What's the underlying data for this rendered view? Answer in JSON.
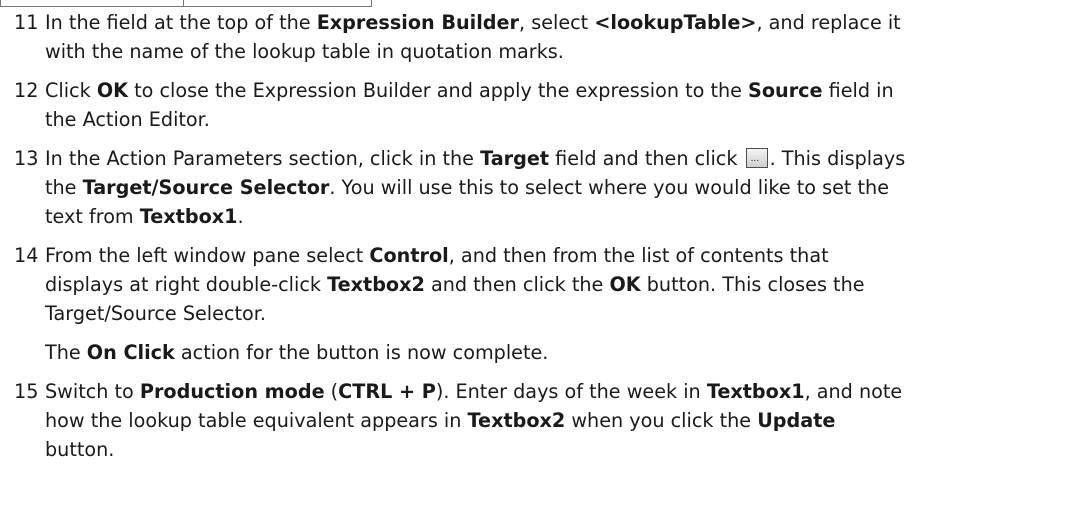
{
  "steps": [
    {
      "num": "11",
      "parts": [
        {
          "t": "In the field at the top of the "
        },
        {
          "t": "Expression Builder",
          "b": true
        },
        {
          "t": ", select "
        },
        {
          "t": "<lookupTable>",
          "b": true
        },
        {
          "t": ", and replace it\nwith the name of the lookup table in quotation marks."
        }
      ]
    },
    {
      "num": "12",
      "parts": [
        {
          "t": "Click "
        },
        {
          "t": "OK",
          "b": true
        },
        {
          "t": " to close the Expression Builder and apply the expression to the "
        },
        {
          "t": "Source",
          "b": true
        },
        {
          "t": " field in\nthe Action Editor."
        }
      ]
    },
    {
      "num": "13",
      "parts": [
        {
          "t": "In the Action Parameters section, click in the "
        },
        {
          "t": "Target",
          "b": true
        },
        {
          "t": " field and then click "
        },
        {
          "icon": "ellipsis-button-icon",
          "label": "..."
        },
        {
          "t": ". This displays\nthe "
        },
        {
          "t": "Target/Source Selector",
          "b": true
        },
        {
          "t": ". You will use this to select where you would like to set the\ntext from "
        },
        {
          "t": "Textbox1",
          "b": true
        },
        {
          "t": "."
        }
      ]
    },
    {
      "num": "14",
      "parts": [
        {
          "t": "From the left window pane select "
        },
        {
          "t": "Control",
          "b": true
        },
        {
          "t": ", and then from the list of contents that\ndisplays at right double-click "
        },
        {
          "t": "Textbox2",
          "b": true
        },
        {
          "t": " and then click the "
        },
        {
          "t": "OK",
          "b": true
        },
        {
          "t": " button. This closes the\nTarget/Source Selector."
        }
      ]
    },
    {
      "note": true,
      "parts": [
        {
          "t": "The "
        },
        {
          "t": "On Click",
          "b": true
        },
        {
          "t": " action for the button is now complete."
        }
      ]
    },
    {
      "num": "15",
      "parts": [
        {
          "t": "Switch to "
        },
        {
          "t": "Production mode",
          "b": true
        },
        {
          "t": " ("
        },
        {
          "t": "CTRL + P",
          "b": true
        },
        {
          "t": "). Enter days of the week in "
        },
        {
          "t": "Textbox1",
          "b": true
        },
        {
          "t": ", and note\nhow the lookup table equivalent appears in "
        },
        {
          "t": "Textbox2",
          "b": true
        },
        {
          "t": " when you click the "
        },
        {
          "t": "Update",
          "b": true
        },
        {
          "t": "\nbutton."
        }
      ]
    }
  ]
}
